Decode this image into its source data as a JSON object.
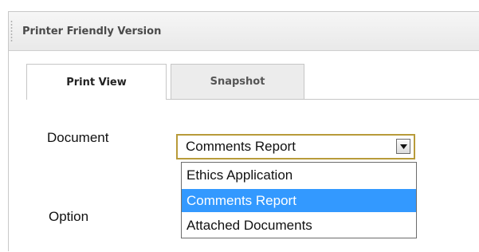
{
  "panel": {
    "title": "Printer Friendly Version"
  },
  "tabs": [
    {
      "label": "Print View",
      "active": true
    },
    {
      "label": "Snapshot",
      "active": false
    }
  ],
  "form": {
    "document_label": "Document",
    "option_label": "Option",
    "document_select": {
      "value": "Comments Report",
      "options": [
        "Ethics Application",
        "Comments Report",
        "Attached Documents"
      ],
      "highlighted": "Comments Report",
      "arrow_icon": "chevron-down-icon"
    }
  },
  "colors": {
    "highlight": "#3399ff",
    "select_focus_border": "#b89b3a"
  }
}
